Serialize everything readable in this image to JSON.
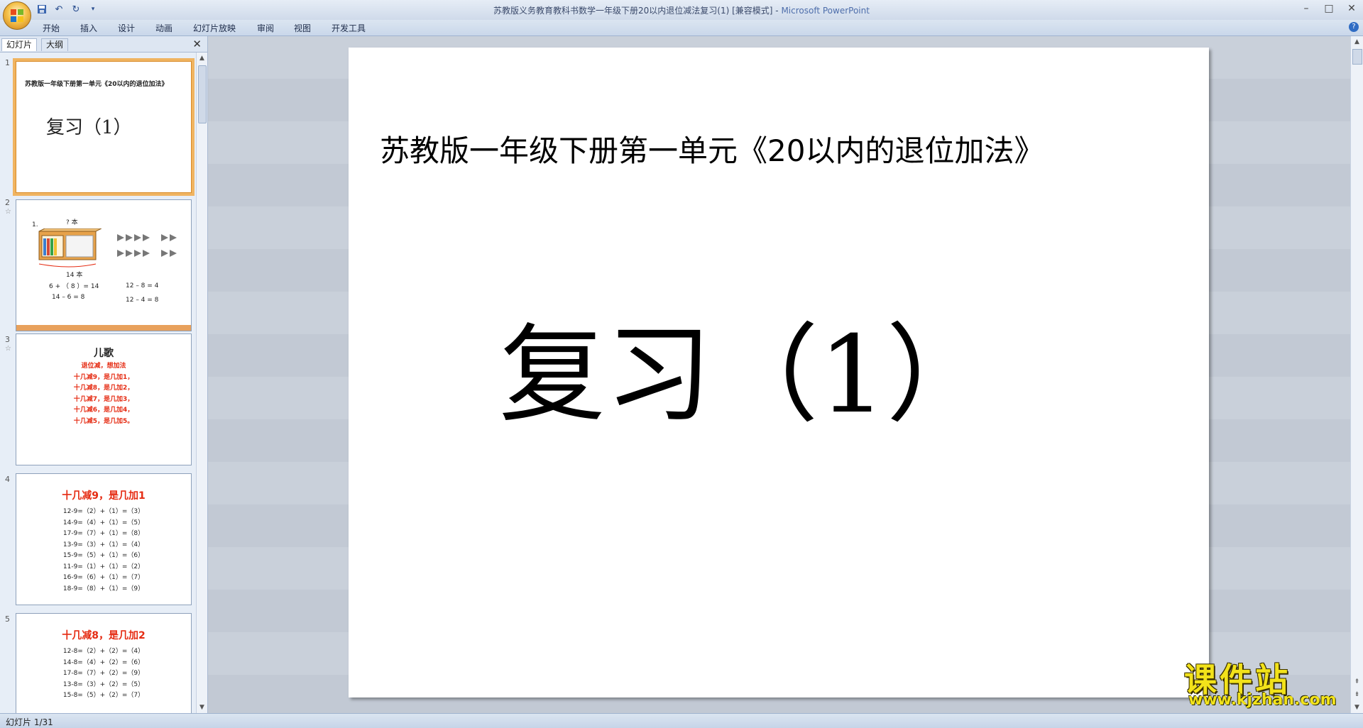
{
  "window": {
    "title": "苏教版义务教育教科书数学一年级下册20以内退位减法复习(1) [兼容模式]",
    "title_sep": " - ",
    "app_name": "Microsoft PowerPoint",
    "controls": [
      "–",
      "□",
      "✕"
    ]
  },
  "ribbon": {
    "tabs": [
      "开始",
      "插入",
      "设计",
      "动画",
      "幻灯片放映",
      "审阅",
      "视图",
      "开发工具"
    ],
    "help": "?"
  },
  "pane": {
    "tabs": [
      "幻灯片",
      "大纲"
    ],
    "close": "✕"
  },
  "thumbnails": {
    "s1": {
      "num": "1",
      "title": "苏教版一年级下册第一单元《20以内的退位加法》",
      "big": "复习（1）"
    },
    "s2": {
      "num": "2",
      "star": "☆",
      "label_1": "1.",
      "question": "? 本",
      "total": "14 本",
      "eq1": "6 + （ 8 ）= 14",
      "eq2": "14 – 6 = 8",
      "eq3": "12 – 8 = 4",
      "eq4": "12 – 4 = 8"
    },
    "s3": {
      "num": "3",
      "star": "☆",
      "title": "儿歌",
      "lines": [
        "退位减，想加法",
        "十几减9，是几加1，",
        "十几减8，是几加2，",
        "十几减7，是几加3，",
        "十几减6，是几加4，",
        "十几减5，是几加5。"
      ]
    },
    "s4": {
      "num": "4",
      "title": "十几减9，是几加1",
      "lines": [
        "12-9=（2）+（1）=（3）",
        "14-9=（4）+（1）=（5）",
        "17-9=（7）+（1）=（8）",
        "13-9=（3）+（1）=（4）",
        "15-9=（5）+（1）=（6）",
        "11-9=（1）+（1）=（2）",
        "16-9=（6）+（1）=（7）",
        "18-9=（8）+（1）=（9）"
      ]
    },
    "s5": {
      "num": "5",
      "title": "十几减8，是几加2",
      "lines": [
        "12-8=（2）+（2）=（4）",
        "14-8=（4）+（2）=（6）",
        "17-8=（7）+（2）=（9）",
        "13-8=（3）+（2）=（5）",
        "15-8=（5）+（2）=（7）"
      ]
    }
  },
  "slide": {
    "title": "苏教版一年级下册第一单元《20以内的退位加法》",
    "main": "复习（1）"
  },
  "status": {
    "text": "幻灯片 1/31"
  },
  "watermark": {
    "name": "课件站",
    "url": "www.kjzhan.com"
  }
}
